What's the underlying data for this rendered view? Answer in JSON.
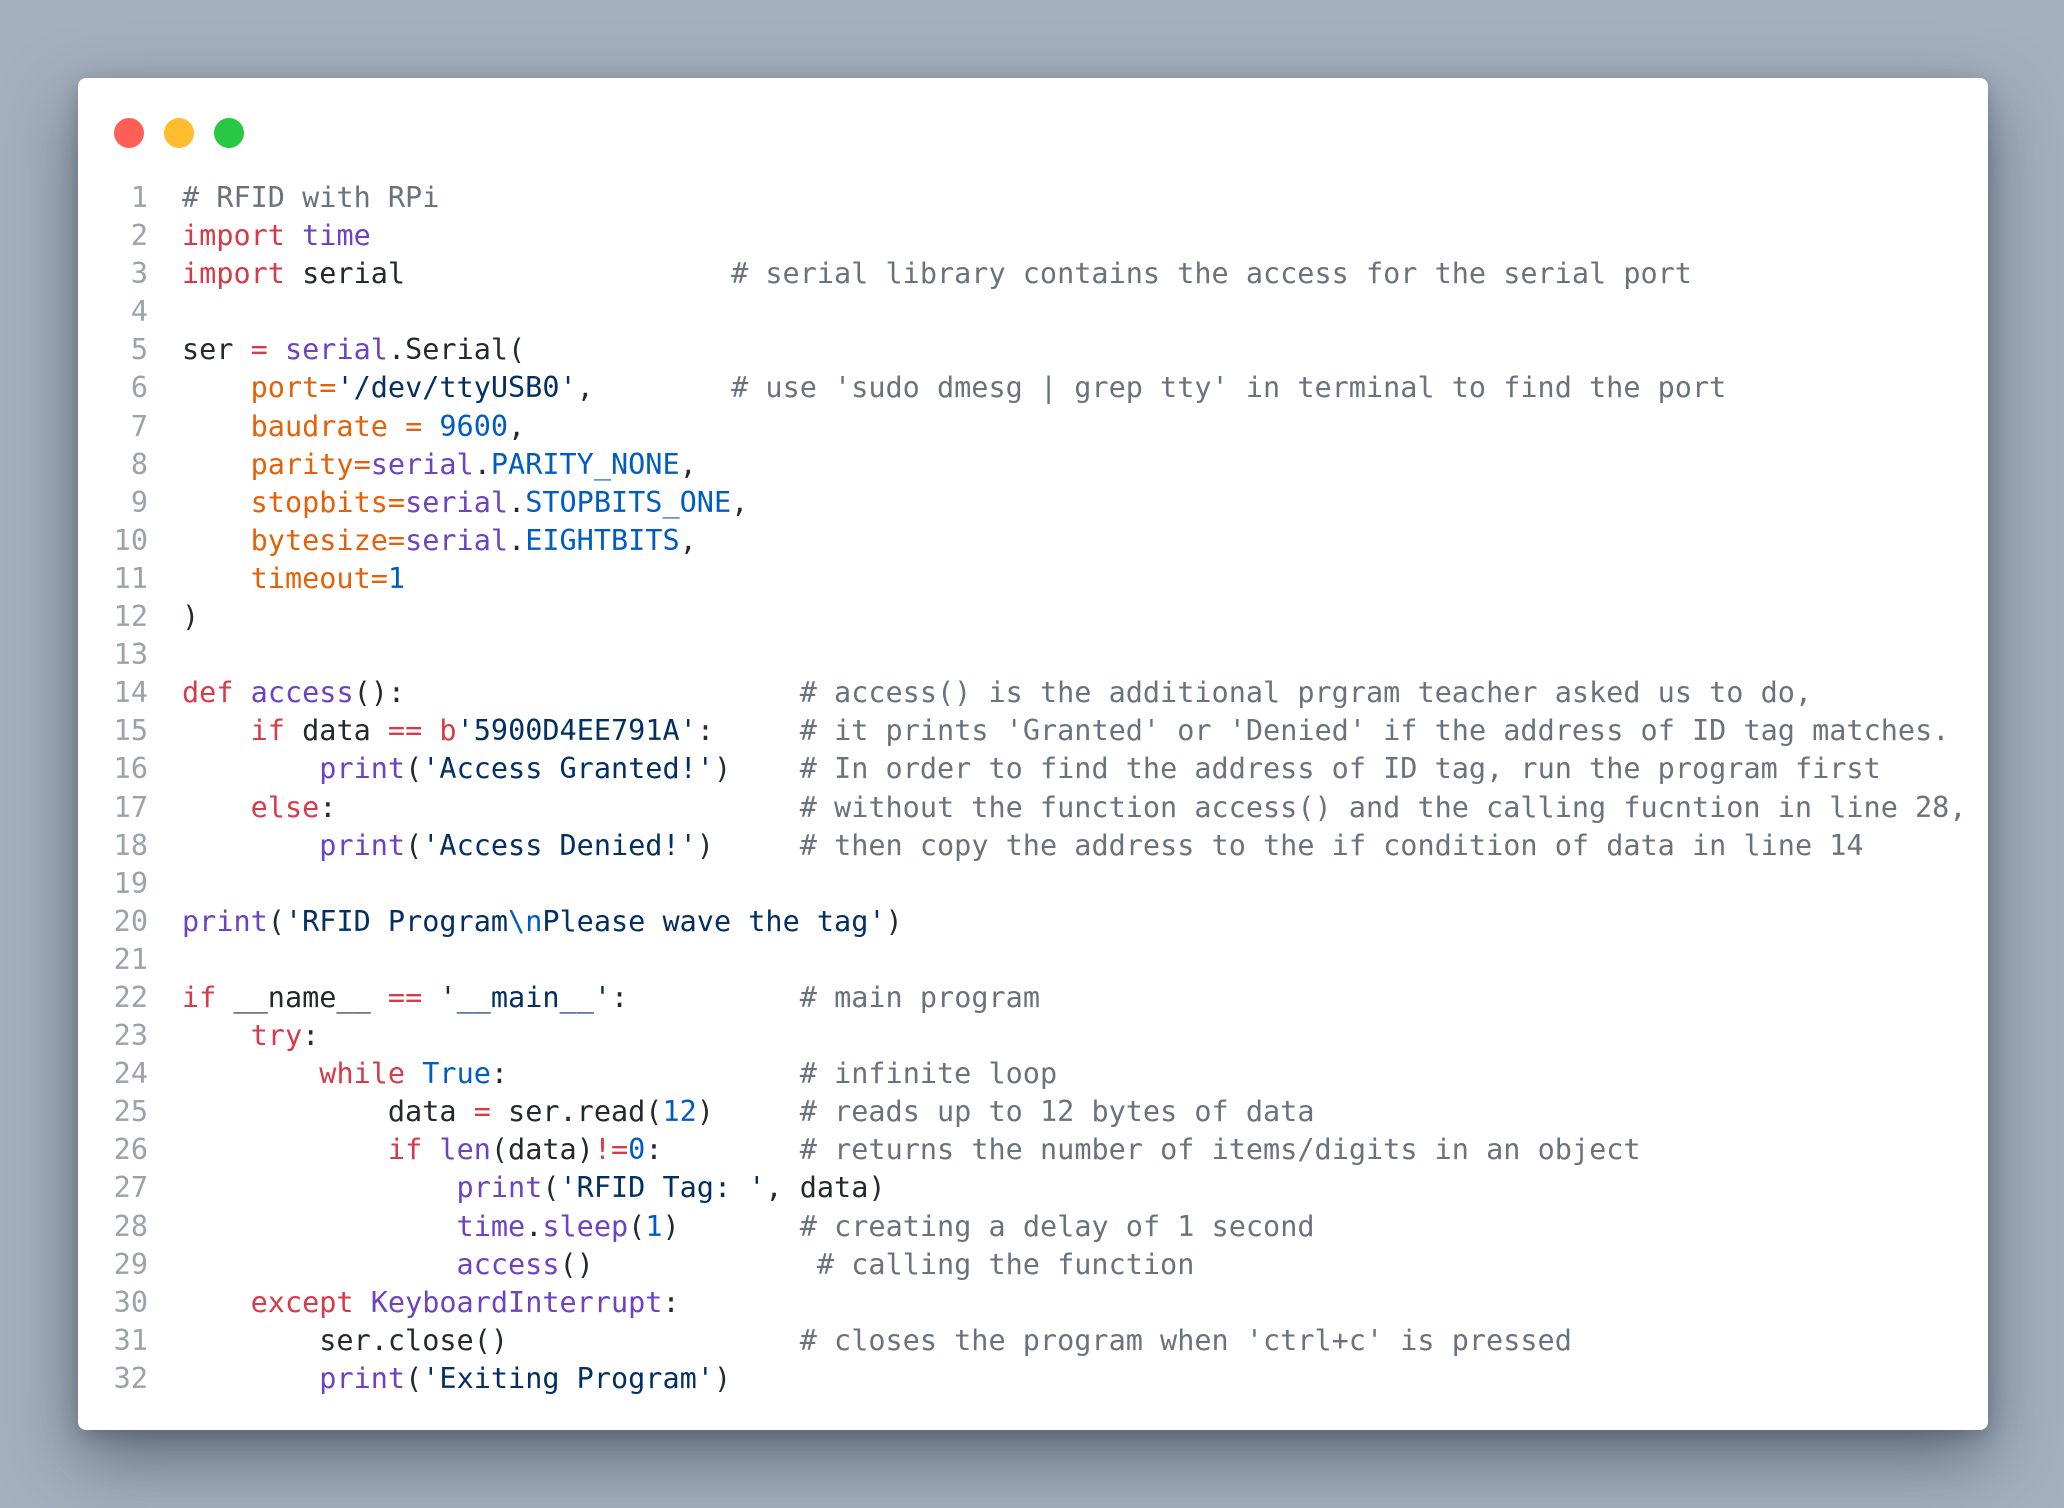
{
  "window": {
    "controls": [
      "close",
      "minimize",
      "maximize"
    ],
    "colors": {
      "close": "#ff5f57",
      "minimize": "#febc2e",
      "maximize": "#28c840"
    }
  },
  "code": {
    "language": "python",
    "lines": [
      {
        "n": "1",
        "tokens": [
          [
            "co",
            "# RFID with RPi"
          ]
        ]
      },
      {
        "n": "2",
        "tokens": [
          [
            "kw",
            "import"
          ],
          [
            "",
            " "
          ],
          [
            "fn",
            "time"
          ]
        ]
      },
      {
        "n": "3",
        "tokens": [
          [
            "kw",
            "import"
          ],
          [
            "",
            " serial"
          ],
          [
            "",
            "                   "
          ],
          [
            "co",
            "# serial library contains the access for the serial port"
          ]
        ]
      },
      {
        "n": "4",
        "tokens": []
      },
      {
        "n": "5",
        "tokens": [
          [
            "",
            "ser "
          ],
          [
            "kw",
            "="
          ],
          [
            "",
            " "
          ],
          [
            "fn",
            "serial"
          ],
          [
            "",
            ".Serial("
          ]
        ]
      },
      {
        "n": "6",
        "tokens": [
          [
            "",
            "    "
          ],
          [
            "pa",
            "port="
          ],
          [
            "st",
            "'/dev/ttyUSB0'"
          ],
          [
            "",
            ",        "
          ],
          [
            "co",
            "# use 'sudo dmesg | grep tty' in terminal to find the port"
          ]
        ]
      },
      {
        "n": "7",
        "tokens": [
          [
            "",
            "    "
          ],
          [
            "pa",
            "baudrate = "
          ],
          [
            "nu",
            "9600"
          ],
          [
            "",
            ","
          ]
        ]
      },
      {
        "n": "8",
        "tokens": [
          [
            "",
            "    "
          ],
          [
            "pa",
            "parity="
          ],
          [
            "fn",
            "serial"
          ],
          [
            "",
            "."
          ],
          [
            "nu",
            "PARITY_NONE"
          ],
          [
            "",
            ","
          ]
        ]
      },
      {
        "n": "9",
        "tokens": [
          [
            "",
            "    "
          ],
          [
            "pa",
            "stopbits="
          ],
          [
            "fn",
            "serial"
          ],
          [
            "",
            "."
          ],
          [
            "nu",
            "STOPBITS_ONE"
          ],
          [
            "",
            ","
          ]
        ]
      },
      {
        "n": "10",
        "tokens": [
          [
            "",
            "    "
          ],
          [
            "pa",
            "bytesize="
          ],
          [
            "fn",
            "serial"
          ],
          [
            "",
            "."
          ],
          [
            "nu",
            "EIGHTBITS"
          ],
          [
            "",
            ","
          ]
        ]
      },
      {
        "n": "11",
        "tokens": [
          [
            "",
            "    "
          ],
          [
            "pa",
            "timeout="
          ],
          [
            "nu",
            "1"
          ]
        ]
      },
      {
        "n": "12",
        "tokens": [
          [
            "",
            ")"
          ]
        ]
      },
      {
        "n": "13",
        "tokens": []
      },
      {
        "n": "14",
        "tokens": [
          [
            "kw",
            "def"
          ],
          [
            "",
            " "
          ],
          [
            "fn",
            "access"
          ],
          [
            "",
            "():                       "
          ],
          [
            "co",
            "# access() is the additional prgram teacher asked us to do,"
          ]
        ]
      },
      {
        "n": "15",
        "tokens": [
          [
            "",
            "    "
          ],
          [
            "kw",
            "if"
          ],
          [
            "",
            " data "
          ],
          [
            "kw",
            "=="
          ],
          [
            "",
            " "
          ],
          [
            "kw",
            "b"
          ],
          [
            "st",
            "'5900D4EE791A'"
          ],
          [
            "",
            ":     "
          ],
          [
            "co",
            "# it prints 'Granted' or 'Denied' if the address of ID tag matches."
          ]
        ]
      },
      {
        "n": "16",
        "tokens": [
          [
            "",
            "        "
          ],
          [
            "fn",
            "print"
          ],
          [
            "",
            "("
          ],
          [
            "st",
            "'Access Granted!'"
          ],
          [
            "",
            ")    "
          ],
          [
            "co",
            "# In order to find the address of ID tag, run the program first"
          ]
        ]
      },
      {
        "n": "17",
        "tokens": [
          [
            "",
            "    "
          ],
          [
            "kw",
            "else"
          ],
          [
            "",
            ":                           "
          ],
          [
            "co",
            "# without the function access() and the calling fucntion in line 28,"
          ]
        ]
      },
      {
        "n": "18",
        "tokens": [
          [
            "",
            "        "
          ],
          [
            "fn",
            "print"
          ],
          [
            "",
            "("
          ],
          [
            "st",
            "'Access Denied!'"
          ],
          [
            "",
            ")     "
          ],
          [
            "co",
            "# then copy the address to the if condition of data in line 14"
          ]
        ]
      },
      {
        "n": "19",
        "tokens": []
      },
      {
        "n": "20",
        "tokens": [
          [
            "fn",
            "print"
          ],
          [
            "",
            "("
          ],
          [
            "st",
            "'RFID Program"
          ],
          [
            "es",
            "\\n"
          ],
          [
            "st",
            "Please wave the tag'"
          ],
          [
            "",
            ")"
          ]
        ]
      },
      {
        "n": "21",
        "tokens": []
      },
      {
        "n": "22",
        "tokens": [
          [
            "kw",
            "if"
          ],
          [
            "",
            " __name__ "
          ],
          [
            "kw",
            "=="
          ],
          [
            "",
            " "
          ],
          [
            "st",
            "'__main__'"
          ],
          [
            "",
            ":          "
          ],
          [
            "co",
            "# main program"
          ]
        ]
      },
      {
        "n": "23",
        "tokens": [
          [
            "",
            "    "
          ],
          [
            "kw",
            "try"
          ],
          [
            "",
            ":"
          ]
        ]
      },
      {
        "n": "24",
        "tokens": [
          [
            "",
            "        "
          ],
          [
            "kw",
            "while"
          ],
          [
            "",
            " "
          ],
          [
            "nu",
            "True"
          ],
          [
            "",
            ":                 "
          ],
          [
            "co",
            "# infinite loop"
          ]
        ]
      },
      {
        "n": "25",
        "tokens": [
          [
            "",
            "            data "
          ],
          [
            "kw",
            "="
          ],
          [
            "",
            " ser.read("
          ],
          [
            "nu",
            "12"
          ],
          [
            "",
            ")     "
          ],
          [
            "co",
            "# reads up to 12 bytes of data"
          ]
        ]
      },
      {
        "n": "26",
        "tokens": [
          [
            "",
            "            "
          ],
          [
            "kw",
            "if"
          ],
          [
            "",
            " "
          ],
          [
            "fn",
            "len"
          ],
          [
            "",
            "(data)"
          ],
          [
            "kw",
            "!="
          ],
          [
            "nu",
            "0"
          ],
          [
            "",
            ":        "
          ],
          [
            "co",
            "# returns the number of items/digits in an object"
          ]
        ]
      },
      {
        "n": "27",
        "tokens": [
          [
            "",
            "                "
          ],
          [
            "fn",
            "print"
          ],
          [
            "",
            "("
          ],
          [
            "st",
            "'RFID Tag: '"
          ],
          [
            "",
            ", data)"
          ]
        ]
      },
      {
        "n": "28",
        "tokens": [
          [
            "",
            "                "
          ],
          [
            "fn",
            "time"
          ],
          [
            "",
            "."
          ],
          [
            "fn",
            "sleep"
          ],
          [
            "",
            "("
          ],
          [
            "nu",
            "1"
          ],
          [
            "",
            ")       "
          ],
          [
            "co",
            "# creating a delay of 1 second"
          ]
        ]
      },
      {
        "n": "29",
        "tokens": [
          [
            "",
            "                "
          ],
          [
            "fn",
            "access"
          ],
          [
            "",
            "()             "
          ],
          [
            "co",
            "# calling the function"
          ]
        ]
      },
      {
        "n": "30",
        "tokens": [
          [
            "",
            "    "
          ],
          [
            "kw",
            "except"
          ],
          [
            "",
            " "
          ],
          [
            "fn",
            "KeyboardInterrupt"
          ],
          [
            "",
            ":"
          ]
        ]
      },
      {
        "n": "31",
        "tokens": [
          [
            "",
            "        ser.close()                 "
          ],
          [
            "co",
            "# closes the program when 'ctrl+c' is pressed"
          ]
        ]
      },
      {
        "n": "32",
        "tokens": [
          [
            "",
            "        "
          ],
          [
            "fn",
            "print"
          ],
          [
            "",
            "("
          ],
          [
            "st",
            "'Exiting Program'"
          ],
          [
            "",
            ")"
          ]
        ]
      }
    ]
  }
}
